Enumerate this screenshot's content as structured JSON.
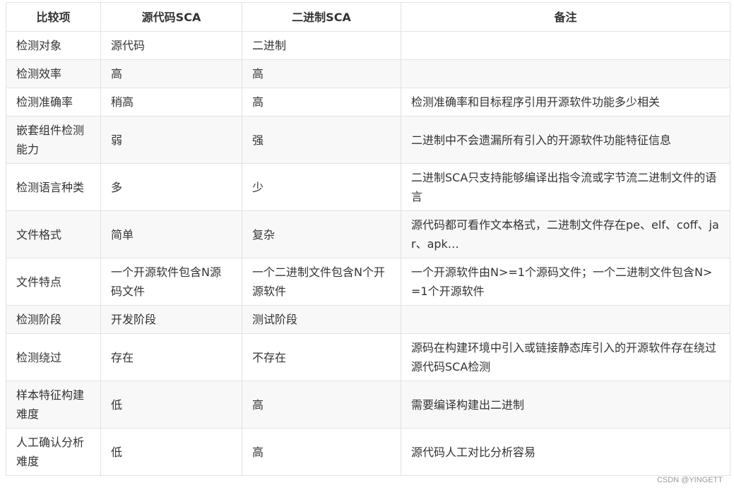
{
  "table": {
    "headers": [
      "比较项",
      "源代码SCA",
      "二进制SCA",
      "备注"
    ],
    "rows": [
      [
        "检测对象",
        "源代码",
        "二进制",
        ""
      ],
      [
        "检测效率",
        "高",
        "高",
        ""
      ],
      [
        "检测准确率",
        "稍高",
        "高",
        "检测准确率和目标程序引用开源软件功能多少相关"
      ],
      [
        "嵌套组件检测能力",
        "弱",
        "强",
        "二进制中不会遗漏所有引入的开源软件功能特征信息"
      ],
      [
        "检测语言种类",
        "多",
        "少",
        "二进制SCA只支持能够编译出指令流或字节流二进制文件的语言"
      ],
      [
        "文件格式",
        "简单",
        "复杂",
        "源代码都可看作文本格式，二进制文件存在pe、elf、coff、jar、apk…"
      ],
      [
        "文件特点",
        "一个开源软件包含N源码文件",
        "一个二进制文件包含N个开源软件",
        "一个开源软件由N>=1个源码文件；一个二进制文件包含N>=1个开源软件"
      ],
      [
        "检测阶段",
        "开发阶段",
        "测试阶段",
        ""
      ],
      [
        "检测绕过",
        "存在",
        "不存在",
        "源码在构建环境中引入或链接静态库引入的开源软件存在绕过源代码SCA检测"
      ],
      [
        "样本特征构建难度",
        "低",
        "高",
        "需要编译构建出二进制"
      ],
      [
        "人工确认分析难度",
        "低",
        "高",
        "源代码人工对比分析容易"
      ]
    ]
  },
  "watermark": "CSDN @YINGETT"
}
